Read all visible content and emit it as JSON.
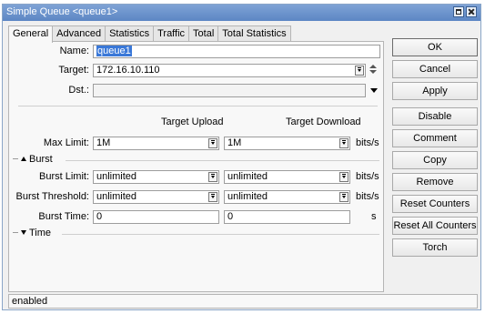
{
  "window": {
    "title": "Simple Queue <queue1>"
  },
  "tabs": [
    "General",
    "Advanced",
    "Statistics",
    "Traffic",
    "Total",
    "Total Statistics"
  ],
  "form": {
    "name_label": "Name:",
    "name_value": "queue1",
    "target_label": "Target:",
    "target_value": "172.16.10.110",
    "dst_label": "Dst.:",
    "dst_value": "",
    "col_upload": "Target Upload",
    "col_download": "Target Download",
    "max_limit_label": "Max Limit:",
    "max_limit_upload": "1M",
    "max_limit_download": "1M",
    "unit": "bits/s",
    "burst_section": "Burst",
    "burst_limit_label": "Burst Limit:",
    "burst_limit_upload": "unlimited",
    "burst_limit_download": "unlimited",
    "burst_threshold_label": "Burst Threshold:",
    "burst_threshold_upload": "unlimited",
    "burst_threshold_download": "unlimited",
    "burst_time_label": "Burst Time:",
    "burst_time_upload": "0",
    "burst_time_download": "0",
    "burst_time_unit": "s",
    "time_section": "Time"
  },
  "buttons": {
    "ok": "OK",
    "cancel": "Cancel",
    "apply": "Apply",
    "disable": "Disable",
    "comment": "Comment",
    "copy": "Copy",
    "remove": "Remove",
    "reset_counters": "Reset Counters",
    "reset_all_counters": "Reset All Counters",
    "torch": "Torch"
  },
  "status": "enabled"
}
